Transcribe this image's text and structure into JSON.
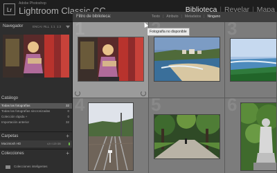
{
  "app": {
    "logo": "Lr",
    "vendor": "Adobe Photoshop",
    "name": "Lightroom Classic CC",
    "modules": [
      "Biblioteca",
      "Revelar",
      "Mapa"
    ],
    "active_module": "Biblioteca"
  },
  "navigator": {
    "title": "Navegador",
    "modes": "ENCAI  RLL  1:1  1:3"
  },
  "catalog": {
    "title": "Catálogo",
    "items": [
      {
        "label": "Todas las fotografías",
        "count": "32"
      },
      {
        "label": "Todas las fotografías sincronizadas",
        "count": "0"
      },
      {
        "label": "Colección rápida +",
        "count": "0"
      },
      {
        "label": "Importación anterior",
        "count": "32"
      }
    ],
    "selected_index": 0
  },
  "folders": {
    "title": "Carpetas",
    "add": "+",
    "volume_name": "Macintosh HD",
    "volume_capacity": "4,9 / 120 GB"
  },
  "collections": {
    "title": "Colecciones",
    "add": "+",
    "smart_label": "Colecciones inteligentes"
  },
  "filter_bar": {
    "title": "Filtro de biblioteca:",
    "tabs": [
      "Texto",
      "Atributo",
      "Metadatos",
      "Ninguno"
    ],
    "active_tab": "Ninguno"
  },
  "grid": {
    "cells": [
      {
        "index": "1",
        "selected": true,
        "image": "girl-with-books"
      },
      {
        "index": "2",
        "selected": false,
        "image": "beach-town"
      },
      {
        "index": "3",
        "selected": false,
        "image": "seaside-bay"
      },
      {
        "index": "4",
        "selected": false,
        "image": "railway-tracks"
      },
      {
        "index": "5",
        "selected": false,
        "image": "park-path"
      },
      {
        "index": "6",
        "selected": false,
        "image": "statue-trees"
      }
    ]
  },
  "tooltip": "Fotografía no disponible",
  "colors": {
    "background": "#1b1b1b",
    "panel": "#2e2e2e",
    "grid_bg": "#6b6b6b",
    "cell": "#7c7c7c",
    "cell_selected": "#9b9b9b",
    "active_text": "#e6e6e6"
  }
}
